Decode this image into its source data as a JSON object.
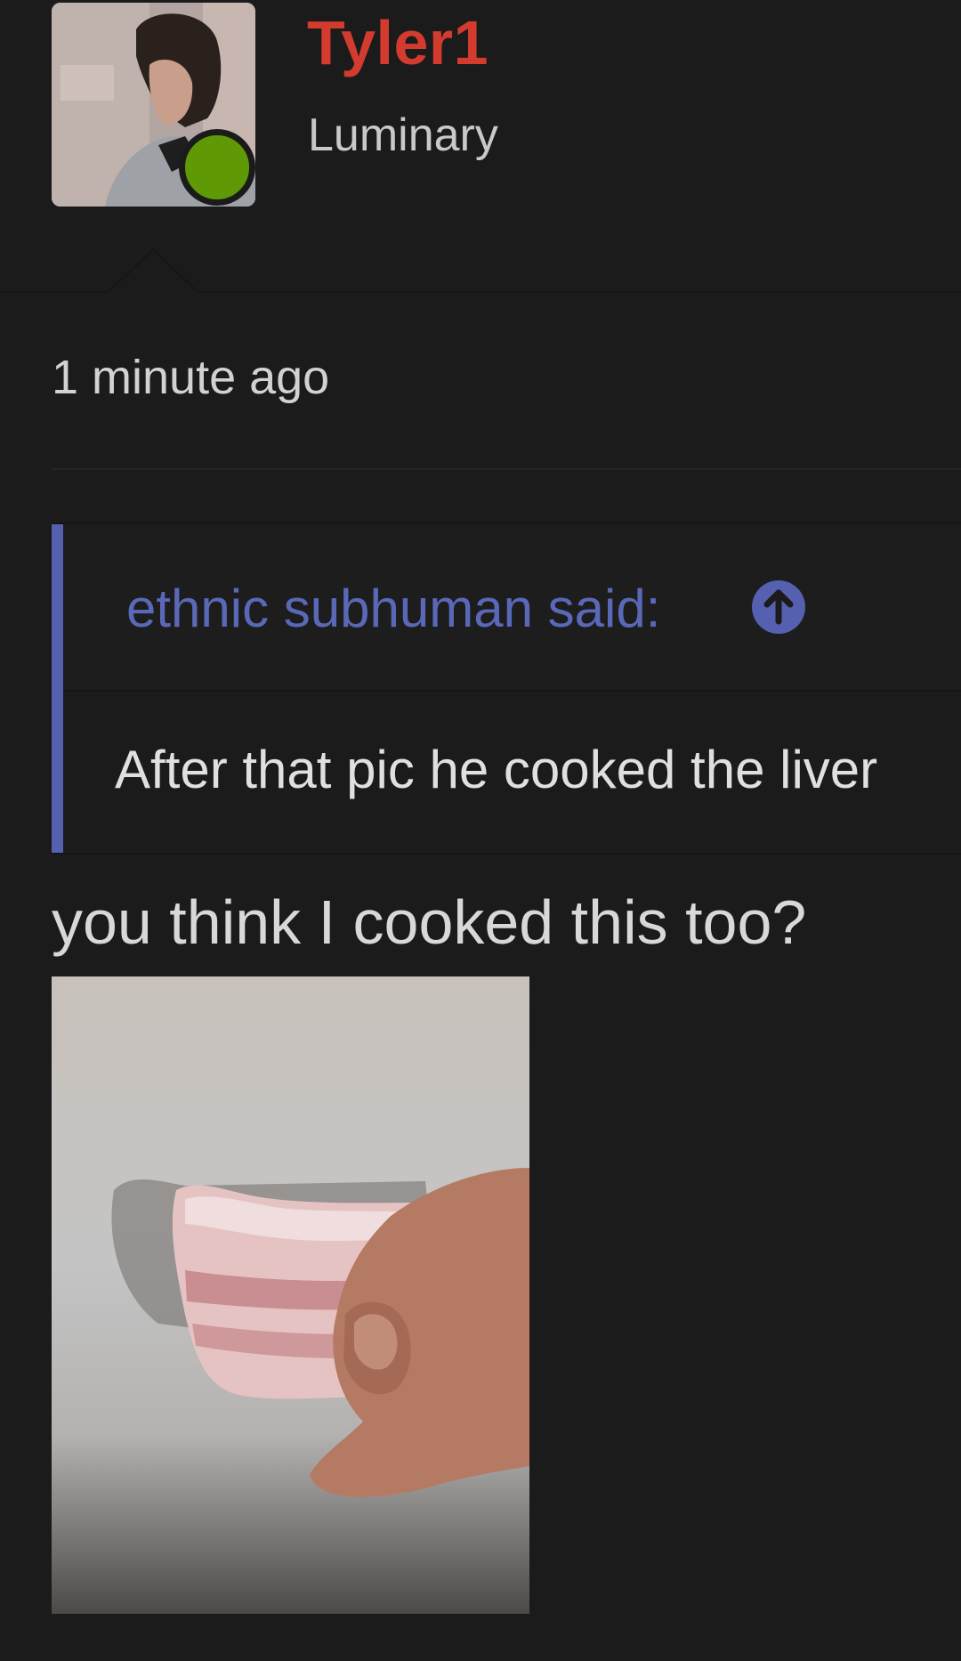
{
  "post": {
    "author": {
      "username": "Tyler1",
      "title": "Luminary",
      "avatar_icon": "avatar-photo",
      "online_status_icon": "online-dot-icon",
      "username_color": "#d43b2f",
      "online_color": "#5f9a06"
    },
    "timestamp": "1 minute ago",
    "quote": {
      "author_label": "ethnic subhuman said:",
      "jump_icon": "arrow-up-circle-icon",
      "text": "After that pic he cooked the liver",
      "accent_color": "#5560b0"
    },
    "message": "you think I cooked this too?",
    "attachment": {
      "type": "image",
      "subject": "hand holding raw pork belly"
    }
  },
  "colors": {
    "background": "#1b1b1b",
    "text_primary": "#d8d8d8",
    "text_secondary": "#c9c9c9"
  }
}
